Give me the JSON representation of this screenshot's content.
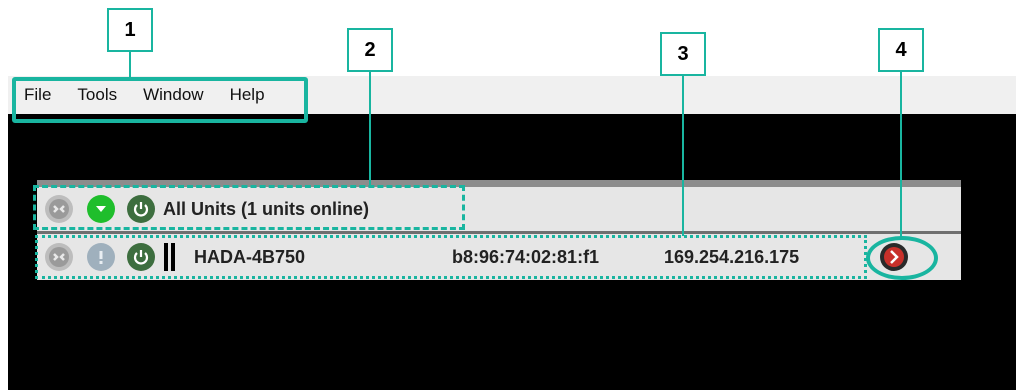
{
  "menu": {
    "items": [
      "File",
      "Tools",
      "Window",
      "Help"
    ]
  },
  "all_units_row": {
    "label": "All Units (1 units online)",
    "icons": [
      "disconnect-icon",
      "dropdown-icon",
      "power-icon"
    ]
  },
  "unit_row": {
    "name": "HADA-4B750",
    "mac": "b8:96:74:02:81:f1",
    "ip": "169.254.216.175",
    "icons": [
      "disconnect-icon",
      "info-icon",
      "power-icon",
      "status-bars-icon",
      "next-arrow-icon"
    ]
  },
  "callouts": [
    "1",
    "2",
    "3",
    "4"
  ],
  "colors": {
    "accent": "#19b5a0",
    "dropdown": "#1fbe2c",
    "power": "#3d6e3f",
    "next": "#c8302a"
  }
}
